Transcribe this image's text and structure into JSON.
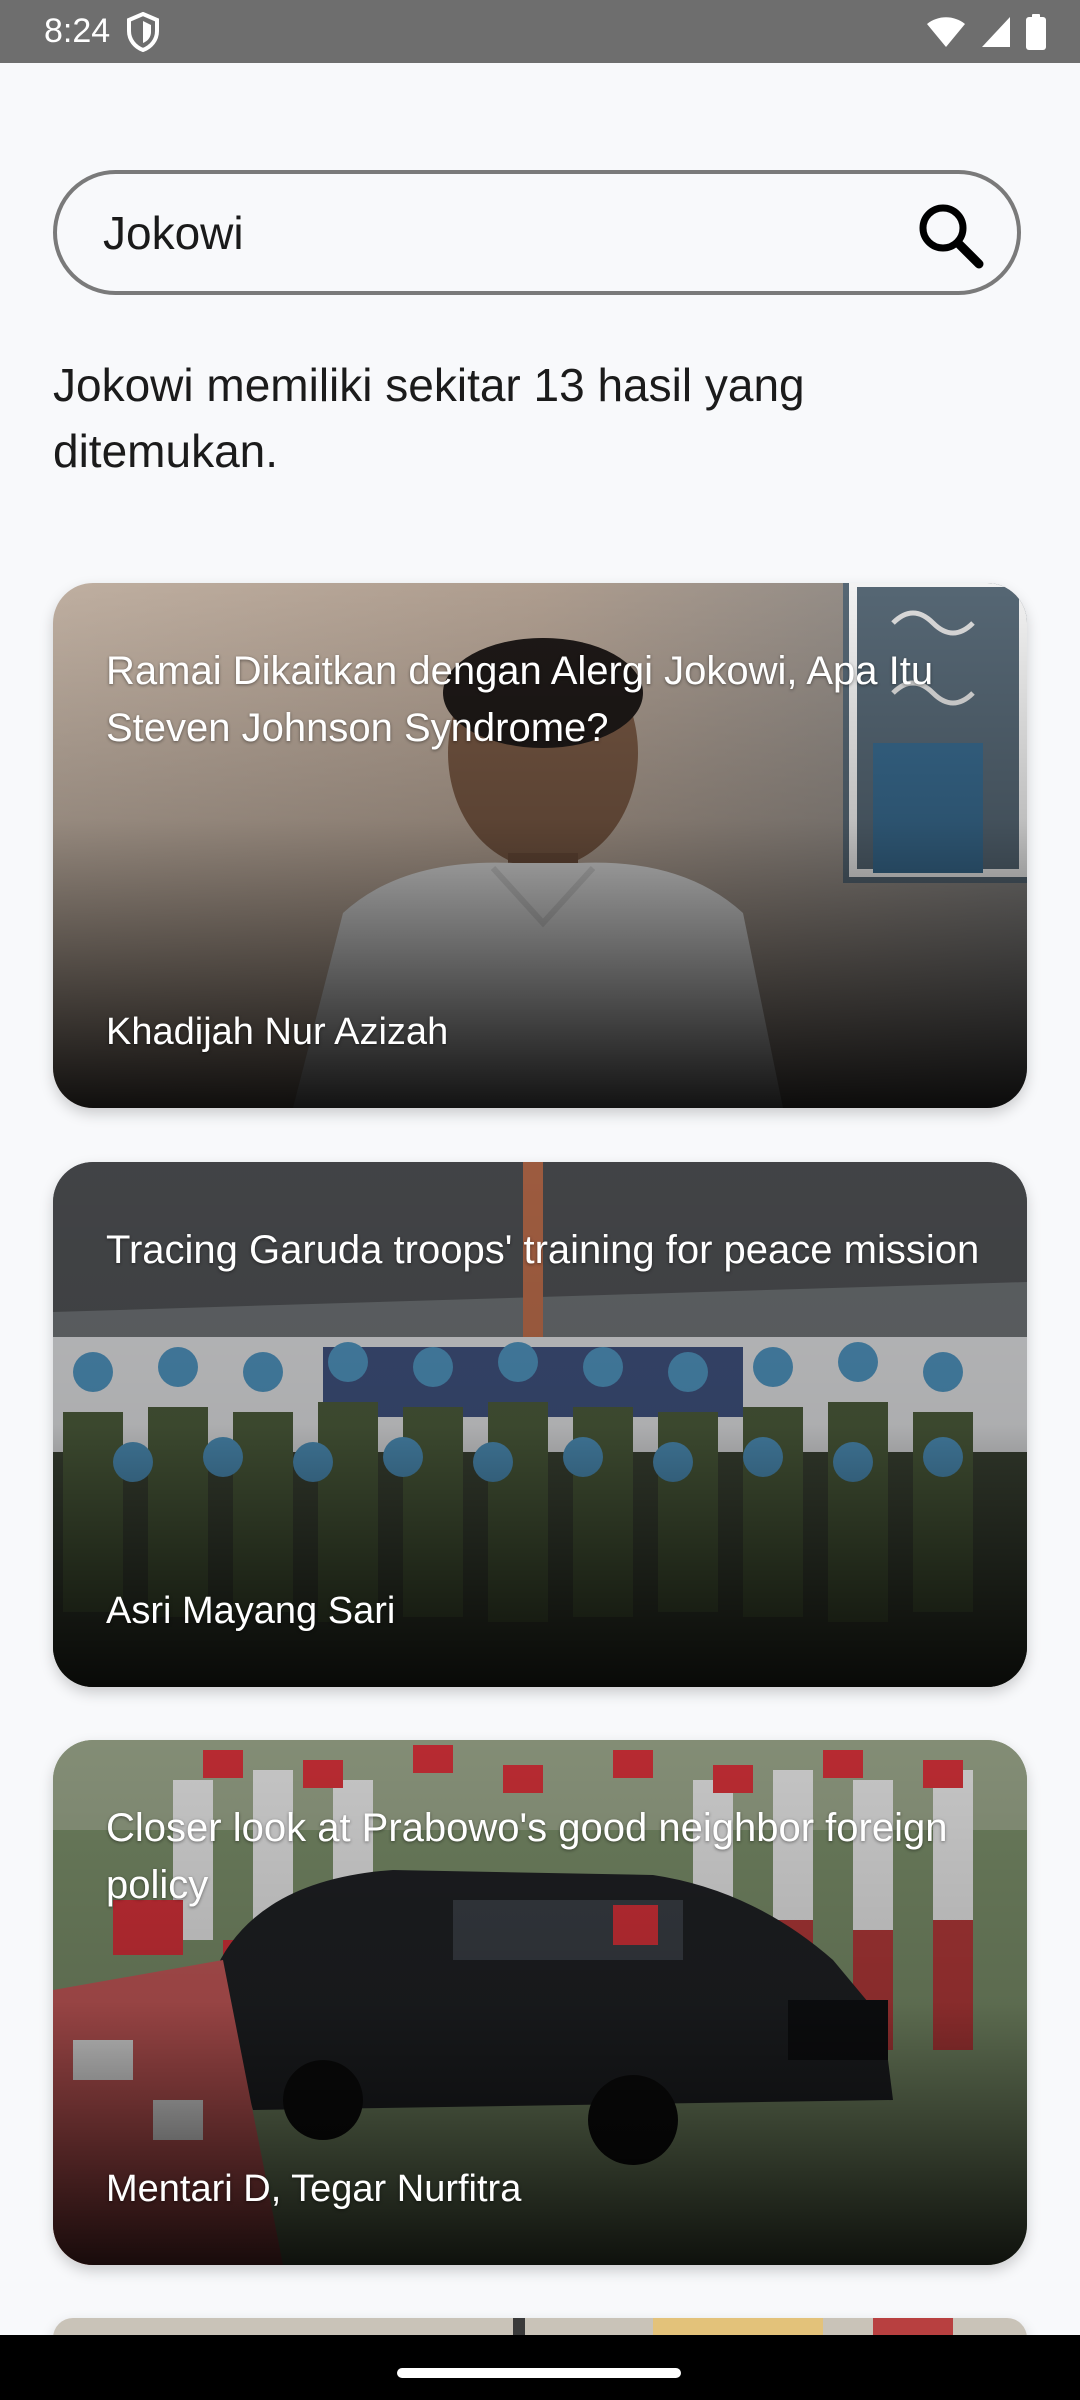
{
  "status_bar": {
    "time": "8:24"
  },
  "search": {
    "value": "Jokowi"
  },
  "result_summary": "Jokowi memiliki sekitar 13 hasil yang ditemukan.",
  "articles": [
    {
      "title": "Ramai Dikaitkan dengan Alergi Jokowi, Apa Itu Steven Johnson Syndrome?",
      "author": "Khadijah Nur Azizah"
    },
    {
      "title": "Tracing Garuda troops' training for peace mission",
      "author": "Asri Mayang Sari"
    },
    {
      "title": "Closer look at Prabowo's good neighbor foreign policy",
      "author": "Mentari D, Tegar Nurfitra"
    }
  ],
  "icons": {
    "status_left": [
      "shield-icon"
    ],
    "status_right": [
      "wifi-icon",
      "signal-icon",
      "battery-icon"
    ],
    "search": "search-icon"
  },
  "colors": {
    "background": "#f8f9fb",
    "status_bar": "#6e6e6e",
    "search_border": "#7a7a7a",
    "text": "#1b1b1b",
    "card_text": "#ffffff"
  }
}
